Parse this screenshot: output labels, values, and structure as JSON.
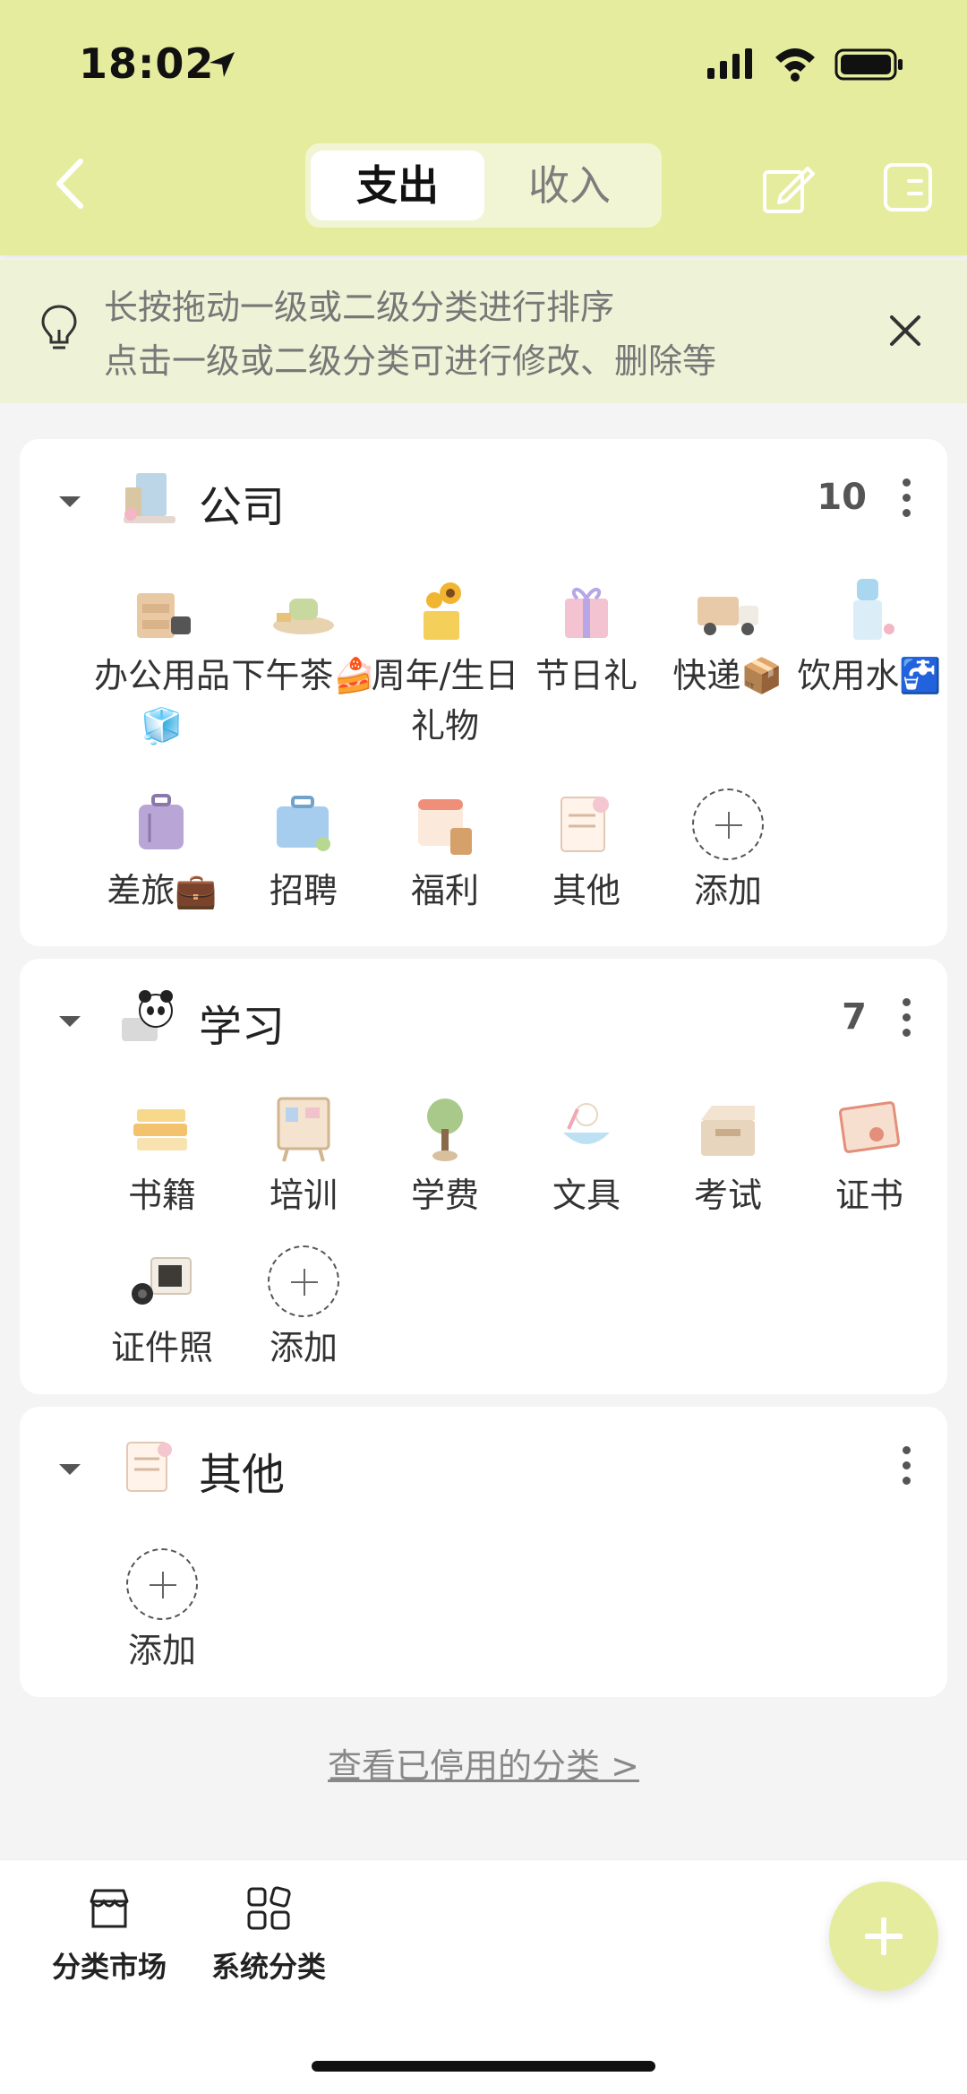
{
  "status": {
    "time": "18:02"
  },
  "header": {
    "tabs": [
      {
        "label": "支出"
      },
      {
        "label": "收入"
      }
    ]
  },
  "tip": {
    "line1": "长按拖动一级或二级分类进行排序",
    "line2": "点击一级或二级分类可进行修改、删除等"
  },
  "groups": [
    {
      "title": "公司",
      "count": "10",
      "items": [
        {
          "label": "办公用品🧊",
          "icon": "office-supplies-icon"
        },
        {
          "label": "下午茶🍰",
          "icon": "afternoon-tea-icon"
        },
        {
          "label": "周年/生日礼物",
          "icon": "sunflower-gift-icon"
        },
        {
          "label": "节日礼",
          "icon": "gift-box-icon"
        },
        {
          "label": "快递📦",
          "icon": "delivery-truck-icon"
        },
        {
          "label": "饮用水🚰",
          "icon": "water-dispenser-icon"
        },
        {
          "label": "差旅💼",
          "icon": "suitcase-icon"
        },
        {
          "label": "招聘",
          "icon": "recruit-bag-icon"
        },
        {
          "label": "福利",
          "icon": "calendar-benefit-icon"
        },
        {
          "label": "其他",
          "icon": "memo-icon"
        }
      ],
      "add_label": "添加"
    },
    {
      "title": "学习",
      "count": "7",
      "items": [
        {
          "label": "书籍",
          "icon": "books-icon"
        },
        {
          "label": "培训",
          "icon": "board-icon"
        },
        {
          "label": "学费",
          "icon": "money-tree-icon"
        },
        {
          "label": "文具",
          "icon": "stationery-icon"
        },
        {
          "label": "考试",
          "icon": "exam-box-icon"
        },
        {
          "label": "证书",
          "icon": "certificate-icon"
        },
        {
          "label": "证件照",
          "icon": "camera-icon"
        }
      ],
      "add_label": "添加"
    },
    {
      "title": "其他",
      "count": "",
      "items": [],
      "add_label": "添加"
    }
  ],
  "footer": {
    "disabled_link": "查看已停用的分类 >"
  },
  "bottom": {
    "tab1": "分类市场",
    "tab2": "系统分类"
  },
  "colors": {
    "accent": "#e6ec9e",
    "tip_bg": "#eef2d6"
  }
}
